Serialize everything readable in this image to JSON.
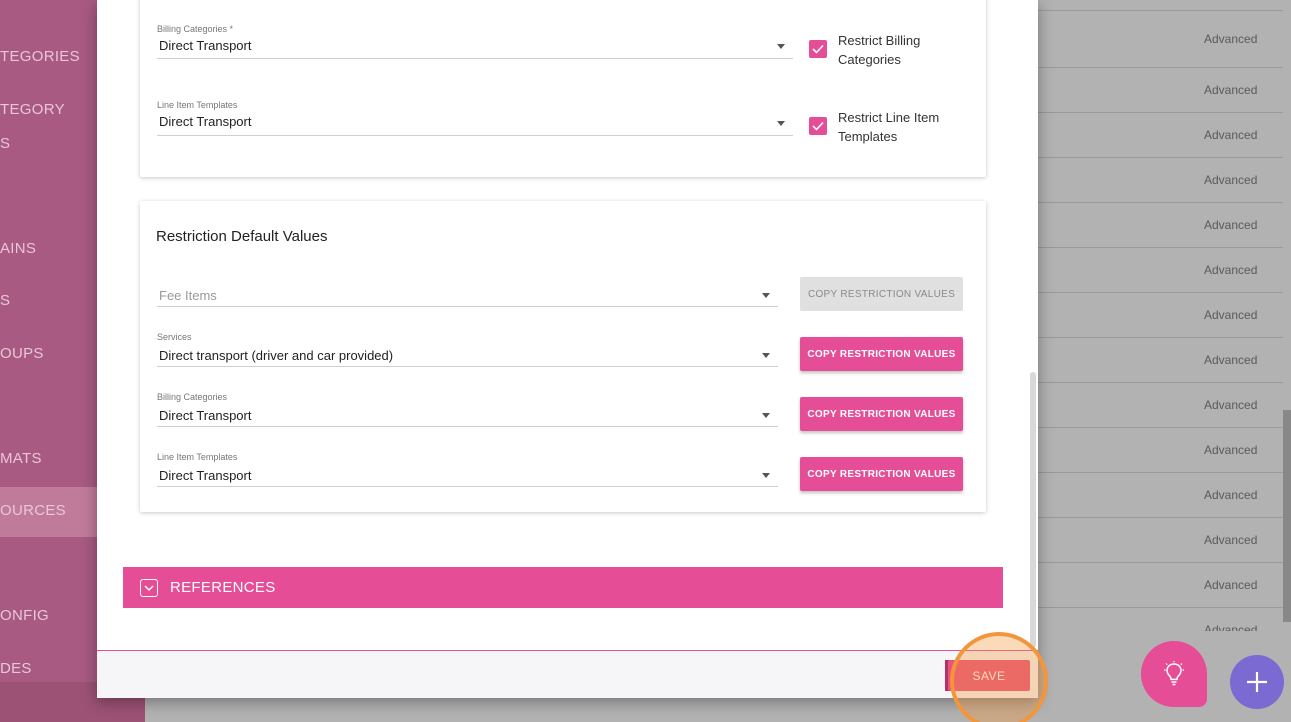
{
  "sidebar": {
    "items": [
      "TEGORIES",
      "TEGORY",
      "S",
      "AINS",
      "S",
      "OUPS",
      "MATS",
      "OURCES",
      "ONFIG",
      "DES"
    ]
  },
  "table": {
    "row_type": [
      "Advanced",
      "Advanced",
      "Advanced",
      "Advanced",
      "Advanced",
      "Advanced",
      "Advanced",
      "Advanced",
      "Advanced",
      "Advanced",
      "Advanced",
      "Advanced",
      "Advanced",
      "Advanced"
    ]
  },
  "restrictions": {
    "billing_categories": {
      "label": "Billing Categories *",
      "value": "Direct Transport",
      "checkbox_label": "Restrict Billing Categories",
      "checked": true
    },
    "line_item_templates": {
      "label": "Line Item Templates",
      "value": "Direct Transport",
      "checkbox_label": "Restrict Line Item Templates",
      "checked": true
    }
  },
  "defaults": {
    "title": "Restriction Default Values",
    "fee_items": {
      "placeholder": "Fee Items",
      "button": "COPY RESTRICTION VALUES"
    },
    "services": {
      "label": "Services",
      "value": "Direct transport (driver and car provided)",
      "button": "COPY RESTRICTION VALUES"
    },
    "billing_categories": {
      "label": "Billing Categories",
      "value": "Direct Transport",
      "button": "COPY RESTRICTION VALUES"
    },
    "line_item_templates": {
      "label": "Line Item Templates",
      "value": "Direct Transport",
      "button": "COPY RESTRICTION VALUES"
    }
  },
  "references": {
    "label": "REFERENCES"
  },
  "footer": {
    "save_label": "SAVE"
  },
  "colors": {
    "accent": "#e54e96",
    "fab_secondary": "#7a6ad1",
    "highlight": "#f3953a"
  },
  "icons": {
    "bulb": "lightbulb-icon",
    "plus": "plus-icon",
    "chevron": "chevron-down-icon",
    "check": "check-icon"
  }
}
